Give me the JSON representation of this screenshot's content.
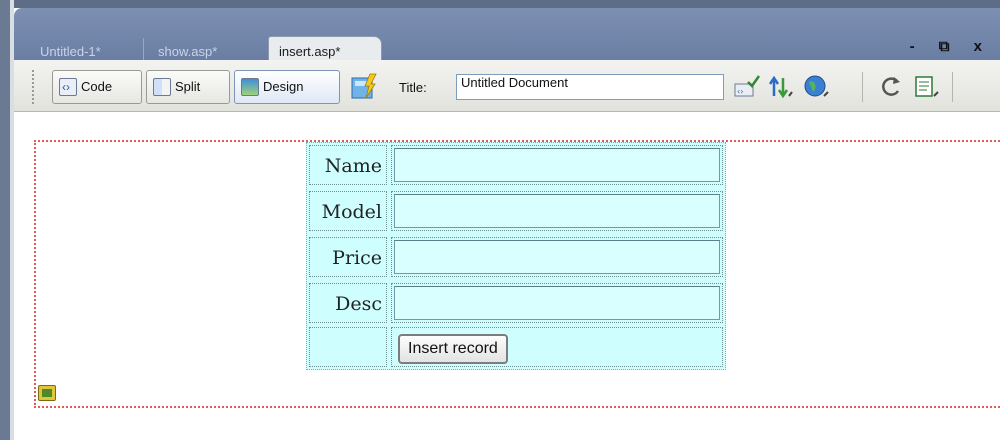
{
  "tabs": [
    {
      "label": "Untitled-1*",
      "active": false
    },
    {
      "label": "show.asp*",
      "active": false
    },
    {
      "label": "insert.asp*",
      "active": true
    }
  ],
  "window_controls": "- ⧉ x",
  "toolbar": {
    "code_label": "Code",
    "split_label": "Split",
    "design_label": "Design",
    "title_label": "Title:",
    "title_value": "Untitled Document",
    "icons": [
      "live-view-icon",
      "validate-icon",
      "file-management-icon",
      "preview-globe-icon",
      "refresh-icon",
      "view-options-icon"
    ]
  },
  "form": {
    "fields": [
      {
        "label": "Name"
      },
      {
        "label": "Model"
      },
      {
        "label": "Price"
      },
      {
        "label": "Desc"
      }
    ],
    "submit_label": "Insert record"
  },
  "colors": {
    "tabbar": "#6a7ea3",
    "form_table_bg": "#cffeff",
    "form_outline": "#e05a5a"
  }
}
